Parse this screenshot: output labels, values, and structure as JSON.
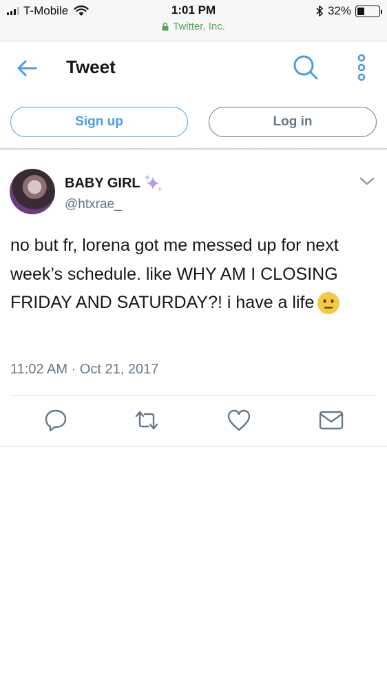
{
  "status_bar": {
    "carrier": "T-Mobile",
    "time": "1:01 PM",
    "site": "Twitter, Inc.",
    "battery": "32%"
  },
  "header": {
    "title": "Tweet"
  },
  "auth": {
    "signup_label": "Sign up",
    "login_label": "Log in"
  },
  "tweet": {
    "author_name": "BABY GIRL",
    "handle": "@htxrae_",
    "text": "no but fr, lorena got me messed up for next week’s schedule. like WHY AM I CLOSING FRIDAY AND SATURDAY?! i have a life",
    "timestamp": "11:02 AM · Oct 21, 2017"
  },
  "icons": {
    "back": "back-arrow-icon",
    "search": "search-icon",
    "more": "more-vertical-icon",
    "sparkles": "sparkles-icon",
    "chevron": "chevron-down-icon",
    "emoji": "neutral-face-emoji",
    "reply": "reply-icon",
    "retweet": "retweet-icon",
    "like": "heart-icon",
    "dm": "mail-icon"
  },
  "colors": {
    "accent": "#4a9de2",
    "muted": "#657786",
    "lock_green": "#53a653"
  }
}
